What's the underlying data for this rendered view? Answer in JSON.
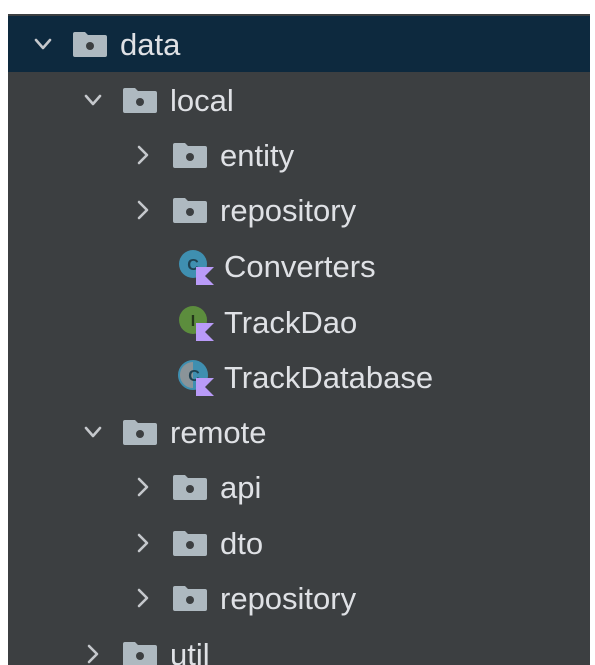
{
  "tree": {
    "items": [
      {
        "label": "data",
        "kind": "folder",
        "expanded": true,
        "selected": true
      },
      {
        "label": "local",
        "kind": "folder",
        "expanded": true
      },
      {
        "label": "entity",
        "kind": "folder",
        "expanded": false
      },
      {
        "label": "repository",
        "kind": "folder",
        "expanded": false
      },
      {
        "label": "Converters",
        "kind": "kotlin-class"
      },
      {
        "label": "TrackDao",
        "kind": "kotlin-interface"
      },
      {
        "label": "TrackDatabase",
        "kind": "kotlin-abstract-class"
      },
      {
        "label": "remote",
        "kind": "folder",
        "expanded": true
      },
      {
        "label": "api",
        "kind": "folder",
        "expanded": false
      },
      {
        "label": "dto",
        "kind": "folder",
        "expanded": false
      },
      {
        "label": "repository",
        "kind": "folder",
        "expanded": false
      },
      {
        "label": "util",
        "kind": "folder",
        "expanded": false
      }
    ]
  },
  "colors": {
    "panel_bg": "#3c3f41",
    "selected_bg": "#0d293e",
    "text": "#dfe1e5",
    "folder": "#aeb9c0",
    "class_blue": "#3f8fb0",
    "interface_green": "#5c8d3d",
    "kotlin_purple": "#b99bf8"
  },
  "icons": {
    "expanded": "chevron-down-icon",
    "collapsed": "chevron-right-icon",
    "folder": "folder-icon",
    "kotlin-class": "kotlin-class-icon",
    "kotlin-interface": "kotlin-interface-icon",
    "kotlin-abstract-class": "kotlin-abstract-class-icon"
  }
}
